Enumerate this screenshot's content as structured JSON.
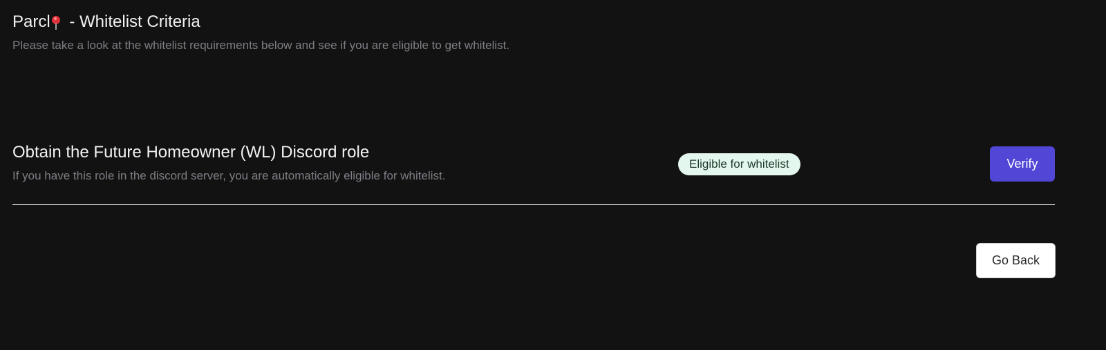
{
  "header": {
    "title_prefix": "Parcl",
    "title_suffix": " - Whitelist Criteria",
    "pin_icon": "round-pushpin-icon",
    "subtitle": "Please take a look at the whitelist requirements below and see if you are eligible to get whitelist."
  },
  "criteria": {
    "title": "Obtain the Future Homeowner (WL) Discord role",
    "description": "If you have this role in the discord server, you are automatically eligible for whitelist.",
    "status": "Eligible for whitelist",
    "verify_label": "Verify"
  },
  "footer": {
    "back_label": "Go Back"
  },
  "colors": {
    "background": "#121212",
    "accent": "#5146d6",
    "badge_bg": "#e4f7ee",
    "muted_text": "#7d7f85"
  }
}
